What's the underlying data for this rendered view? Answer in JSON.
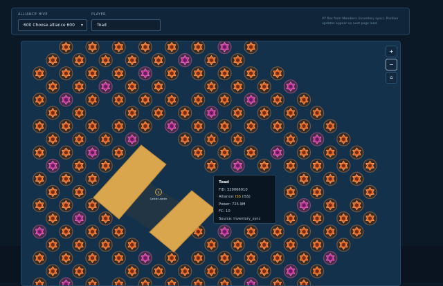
{
  "toolbar": {
    "alliance_label": "ALLIANCE HIVE",
    "alliance_value": "600 Choose alliance 600",
    "player_label": "PLAYER",
    "player_value": "Toad",
    "hint_line1": "VY flex from Members (inventory sync). Position",
    "hint_line2": "updates appear on next page load."
  },
  "zoom": {
    "in": "+",
    "out": "−",
    "home": "⌂"
  },
  "castle_label": "Castle Leader",
  "tooltip": {
    "name": "Toad",
    "fid_label": "FID:",
    "fid": "329066910",
    "alliance_label": "Alliance:",
    "alliance": "ISS",
    "alliance_suffix": "(ISS)",
    "power_label": "Power:",
    "power": "725.9M",
    "fc_label": "FC:",
    "fc": "10",
    "source_label": "Source:",
    "source": "inventory_sync"
  },
  "colors": {
    "background": "#0b1826",
    "map": "#14314b",
    "orange_marker": "#e0682a",
    "pink_marker": "#c0389a",
    "gold_turret": "#d9a64e",
    "highlight": "#f2c230"
  },
  "icons": {
    "select": "chevron-down-icon",
    "marker": "star-badge-icon",
    "castle": "castle-icon"
  }
}
